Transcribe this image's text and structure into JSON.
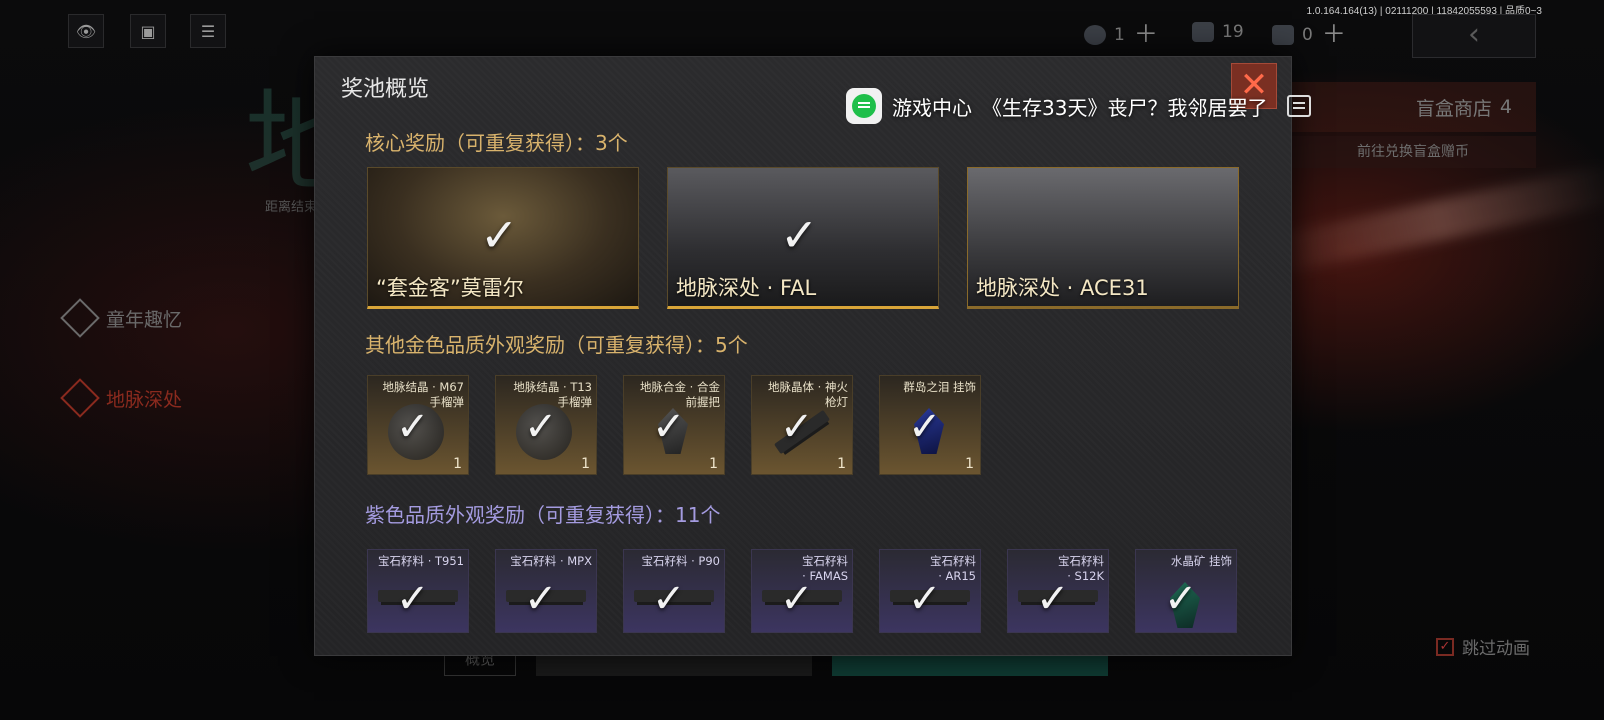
{
  "version": "1.0.164.164(13) | 02111200 | 11842055593 | 品质0~3",
  "top_icons": [
    "eye-icon",
    "camera-icon",
    "list-icon"
  ],
  "currencies": [
    {
      "icon": "gem-currency-icon",
      "value": "1"
    },
    {
      "icon": "ticket-currency-icon",
      "value": "19"
    },
    {
      "icon": "coupon-currency-icon",
      "value": "0"
    }
  ],
  "shop": {
    "label": "盲盒商店",
    "count": "4",
    "link": "前往兑换盲盒赠币"
  },
  "background": {
    "logo_char": "地",
    "countdown": "距离结束"
  },
  "sidebar": {
    "items": [
      {
        "label": "童年趣忆"
      },
      {
        "label": "地脉深处"
      }
    ]
  },
  "skip_animation": {
    "label": "跳过动画",
    "checked": true
  },
  "under_modal": {
    "overview_tab": "概览"
  },
  "modal": {
    "title": "奖池概览",
    "sections": {
      "core": {
        "title": "核心奖励（可重复获得）：3个"
      },
      "gold": {
        "title": "其他金色品质外观奖励（可重复获得）：5个"
      },
      "purple": {
        "title": "紫色品质外观奖励（可重复获得）：11个"
      }
    },
    "core_items": [
      {
        "name": "“套金客”莫雷尔"
      },
      {
        "name": "地脉深处 · FAL"
      },
      {
        "name": "地脉深处 · ACE31"
      }
    ],
    "gold_items": [
      {
        "line1": "地脉结晶 · M67",
        "line2": "手榴弹",
        "count": "1"
      },
      {
        "line1": "地脉结晶 · T13",
        "line2": "手榴弹",
        "count": "1"
      },
      {
        "line1": "地脉合金 · 合金",
        "line2": "前握把",
        "count": "1"
      },
      {
        "line1": "地脉晶体 · 神火",
        "line2": "枪灯",
        "count": "1"
      },
      {
        "line1": "群岛之泪 挂饰",
        "line2": "",
        "count": "1"
      }
    ],
    "purple_items": [
      {
        "line1": "宝石籽料 · T951",
        "line2": ""
      },
      {
        "line1": "宝石籽料 · MPX",
        "line2": ""
      },
      {
        "line1": "宝石籽料 · P90",
        "line2": ""
      },
      {
        "line1": "宝石籽料",
        "line2": "· FAMAS"
      },
      {
        "line1": "宝石籽料",
        "line2": "· AR15"
      },
      {
        "line1": "宝石籽料",
        "line2": "· S12K"
      },
      {
        "line1": "水晶矿 挂饰",
        "line2": ""
      }
    ]
  },
  "notification": {
    "app_name": "游戏中心",
    "message": "《生存33天》丧尸？我邻居罢了"
  },
  "colors": {
    "gold": "#d9b36c",
    "purple": "#a49be0",
    "close": "#7a2f22",
    "accent": "#d9a538"
  }
}
